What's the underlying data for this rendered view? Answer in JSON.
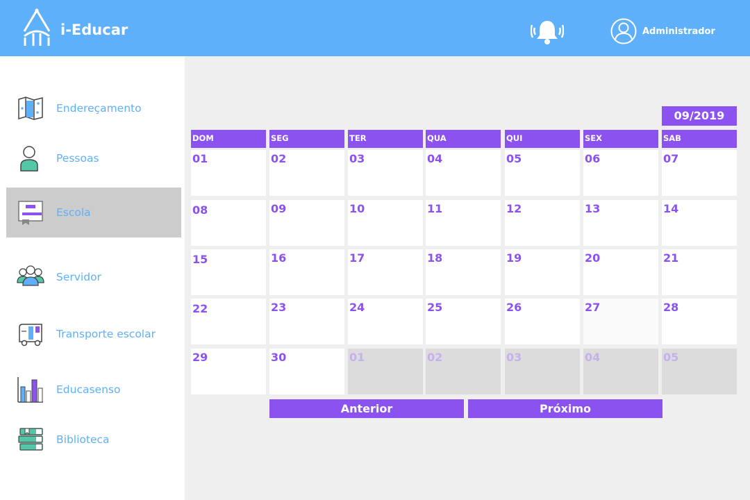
{
  "header": {
    "app_title": "i-Educar",
    "user_name": "Administrador"
  },
  "colors": {
    "header_bg": "#5fb0fb",
    "accent": "#8c52f0",
    "sidebar_active_bg": "#cccccc",
    "content_bg": "#efefef"
  },
  "sidebar": {
    "items": [
      {
        "label": "Endereçamento",
        "icon": "map-icon",
        "active": false
      },
      {
        "label": "Pessoas",
        "icon": "person-icon",
        "active": false
      },
      {
        "label": "Escola",
        "icon": "school-board-icon",
        "active": true
      },
      {
        "label": "Servidor",
        "icon": "group-icon",
        "active": false
      },
      {
        "label": "Transporte escolar",
        "icon": "bus-icon",
        "active": false
      },
      {
        "label": "Educasenso",
        "icon": "bar-chart-icon",
        "active": false
      },
      {
        "label": "Biblioteca",
        "icon": "books-icon",
        "active": false
      }
    ]
  },
  "calendar": {
    "month": "09/2019",
    "weekdays": [
      "DOM",
      "SEG",
      "TER",
      "QUA",
      "QUI",
      "SEX",
      "SAB"
    ],
    "weeks": [
      [
        "01",
        "02",
        "03",
        "04",
        "05",
        "06",
        "07"
      ],
      [
        "08",
        "09",
        "10",
        "11",
        "12",
        "13",
        "14"
      ],
      [
        "15",
        "16",
        "17",
        "18",
        "19",
        "20",
        "21"
      ],
      [
        "22",
        "23",
        "24",
        "25",
        "26",
        "27",
        "28"
      ],
      [
        "29",
        "30",
        "01",
        "02",
        "03",
        "04",
        "05"
      ]
    ],
    "other_month_cells": [
      [
        4,
        2
      ],
      [
        4,
        3
      ],
      [
        4,
        4
      ],
      [
        4,
        5
      ],
      [
        4,
        6
      ]
    ],
    "highlighted_cell": [
      3,
      5
    ],
    "prev_label": "Anterior",
    "next_label": "Próximo"
  }
}
